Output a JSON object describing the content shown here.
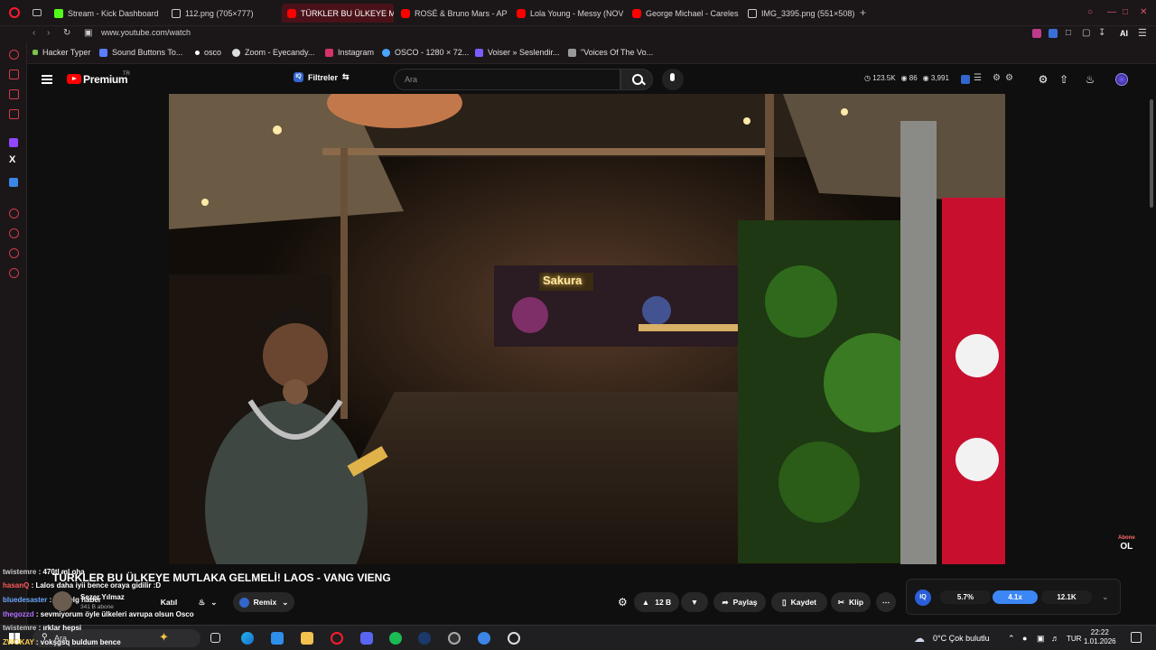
{
  "browser": {
    "tabs": [
      {
        "label": "Stream - Kick Dashboard",
        "color": "#53fc18"
      },
      {
        "label": "112.png (705×777)",
        "color": "#cfcfcf"
      },
      {
        "label": "TÜRKLER BU ÜLKEYE MU",
        "color": "#ff0000",
        "active": true
      },
      {
        "label": "ROSÉ & Bruno Mars - APT",
        "color": "#ff0000"
      },
      {
        "label": "Lola Young - Messy (NOV",
        "color": "#ff0000"
      },
      {
        "label": "George Michael - Careless",
        "color": "#ff0000"
      },
      {
        "label": "IMG_3395.png (551×508)",
        "color": "#cfcfcf"
      }
    ],
    "new_tab": "+",
    "url": "www.youtube.com/watch",
    "bookmarks": [
      {
        "label": "Hacker Typer",
        "color": "#7cc34a"
      },
      {
        "label": "Sound Buttons To...",
        "color": "#5b7dff"
      },
      {
        "label": "osco",
        "color": "#ffffff"
      },
      {
        "label": "Zoom - Eyecandy...",
        "color": "#dddddd"
      },
      {
        "label": "Instagram",
        "color": "#d6336c"
      },
      {
        "label": "OSCO - 1280 × 72...",
        "color": "#4aa3ff"
      },
      {
        "label": "Voiser » Seslendir...",
        "color": "#7c5cff"
      },
      {
        "label": "\"Voices Of The Vo...",
        "color": "#aaaaaa"
      }
    ],
    "ai_label": "AI"
  },
  "youtube": {
    "brand": "Premium",
    "country": "TR",
    "filters_label": "Filtreler",
    "search_placeholder": "Ara",
    "stats": {
      "viewers": "123.5K",
      "watching": "86",
      "count": "3,991"
    },
    "video": {
      "title": "TÜRKLER BU ÜLKEYE MUTLAKA GELMELİ! LAOS - VANG VIENG",
      "sign_text": "Sakura",
      "abone_label": "Abone",
      "ol_label": "OL"
    },
    "channel": {
      "name": "Sezer Yılmaz",
      "subs": "341 B abone"
    },
    "join_label": "Katıl",
    "remix_label": "Remix",
    "likes": "12 B",
    "share_label": "Paylaş",
    "save_label": "Kaydet",
    "clip_label": "Klip",
    "ext_values": {
      "a": "5.7%",
      "b": "4.1x",
      "c": "12.1K"
    }
  },
  "chat": [
    {
      "user": "twistemre",
      "msg": "470tl ml oha",
      "color": "#c8c8c8"
    },
    {
      "user": "hasanQ",
      "msg": "Lalos daha iyii bence oraya gidilir :D",
      "color": "#ff5a5a"
    },
    {
      "user": "bluedesaster",
      "msg": "sofgelg haber",
      "color": "#6aa8ff"
    },
    {
      "user": "thegozzd",
      "msg": "sevmiyorum öyle ülkeleri avrupa olsun Osco",
      "color": "#b06cff"
    },
    {
      "user": "twistemre",
      "msg": "ırklar hepsi",
      "color": "#c8c8c8"
    },
    {
      "user": "ZWOKAY",
      "msg": "vokşgsq buldum bence",
      "color": "#ffd24a"
    }
  ],
  "taskbar": {
    "search_label": "Ara",
    "weather": "0°C  Çok bulutlu",
    "lang": "TUR",
    "time": "22:22",
    "date": "1.01.2026"
  }
}
